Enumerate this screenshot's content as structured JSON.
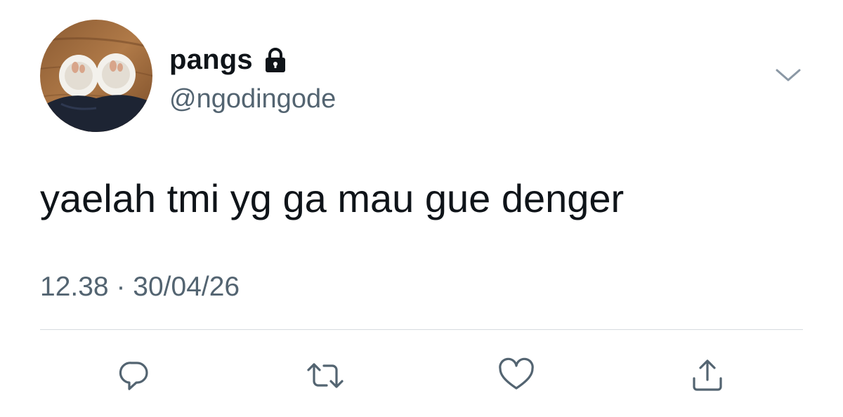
{
  "tweet": {
    "author": {
      "display_name": "pangs",
      "handle": "@ngodingode",
      "avatar_icon": "profile-photo",
      "protected_icon": "lock-icon"
    },
    "text": "yaelah tmi yg ga mau gue denger",
    "time": "12.38",
    "separator": "·",
    "date": "30/04/26"
  },
  "actions": [
    {
      "name": "reply",
      "icon": "reply-icon"
    },
    {
      "name": "retweet",
      "icon": "retweet-icon"
    },
    {
      "name": "like",
      "icon": "heart-icon"
    },
    {
      "name": "share",
      "icon": "share-icon"
    }
  ],
  "menu": {
    "icon": "chevron-down-icon"
  },
  "colors": {
    "text_primary": "#0f1419",
    "text_secondary": "#536471",
    "divider": "#d6dbdf",
    "background": "#ffffff"
  }
}
